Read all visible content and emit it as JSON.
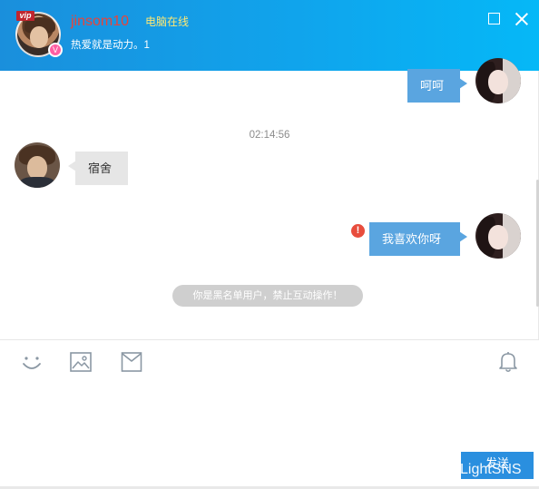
{
  "header": {
    "nickname": "jinsom10",
    "online_status": "电脑在线",
    "signature": "热爱就是动力。1",
    "vip_label": "vip",
    "level_badge": "V"
  },
  "chat": {
    "timestamp": "02:14:56",
    "messages": [
      {
        "side": "right",
        "text": "呵呵"
      },
      {
        "side": "left",
        "text": "宿舍"
      },
      {
        "side": "right",
        "text": "我喜欢你呀",
        "error_mark": "!"
      }
    ],
    "system_notice": "你是黑名单用户，禁止互动操作！"
  },
  "toolbar": {
    "icons": [
      "smile-icon",
      "image-icon",
      "mail-icon",
      "bell-icon"
    ]
  },
  "input": {
    "value": "",
    "placeholder": ""
  },
  "send_button": {
    "label": "发送"
  },
  "watermark": "LightSNS",
  "colors": {
    "header_gradient_start": "#1a8fdc",
    "header_gradient_end": "#05b8f7",
    "bubble_blue": "#5aa5e0",
    "send_button": "#2a8fdf",
    "nickname": "#e8443a",
    "status_yellow": "#ffe873",
    "error_red": "#e84d3d"
  }
}
